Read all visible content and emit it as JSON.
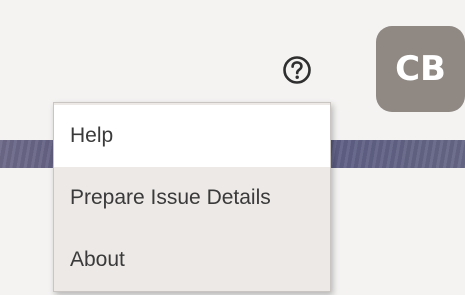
{
  "header": {
    "help_icon": "question-circle-icon",
    "avatar_initials": "CB",
    "avatar_color": "#8f8883"
  },
  "menu": {
    "items": [
      {
        "label": "Help",
        "highlighted": true
      },
      {
        "label": "Prepare Issue Details",
        "highlighted": false
      },
      {
        "label": "About",
        "highlighted": false
      }
    ]
  }
}
